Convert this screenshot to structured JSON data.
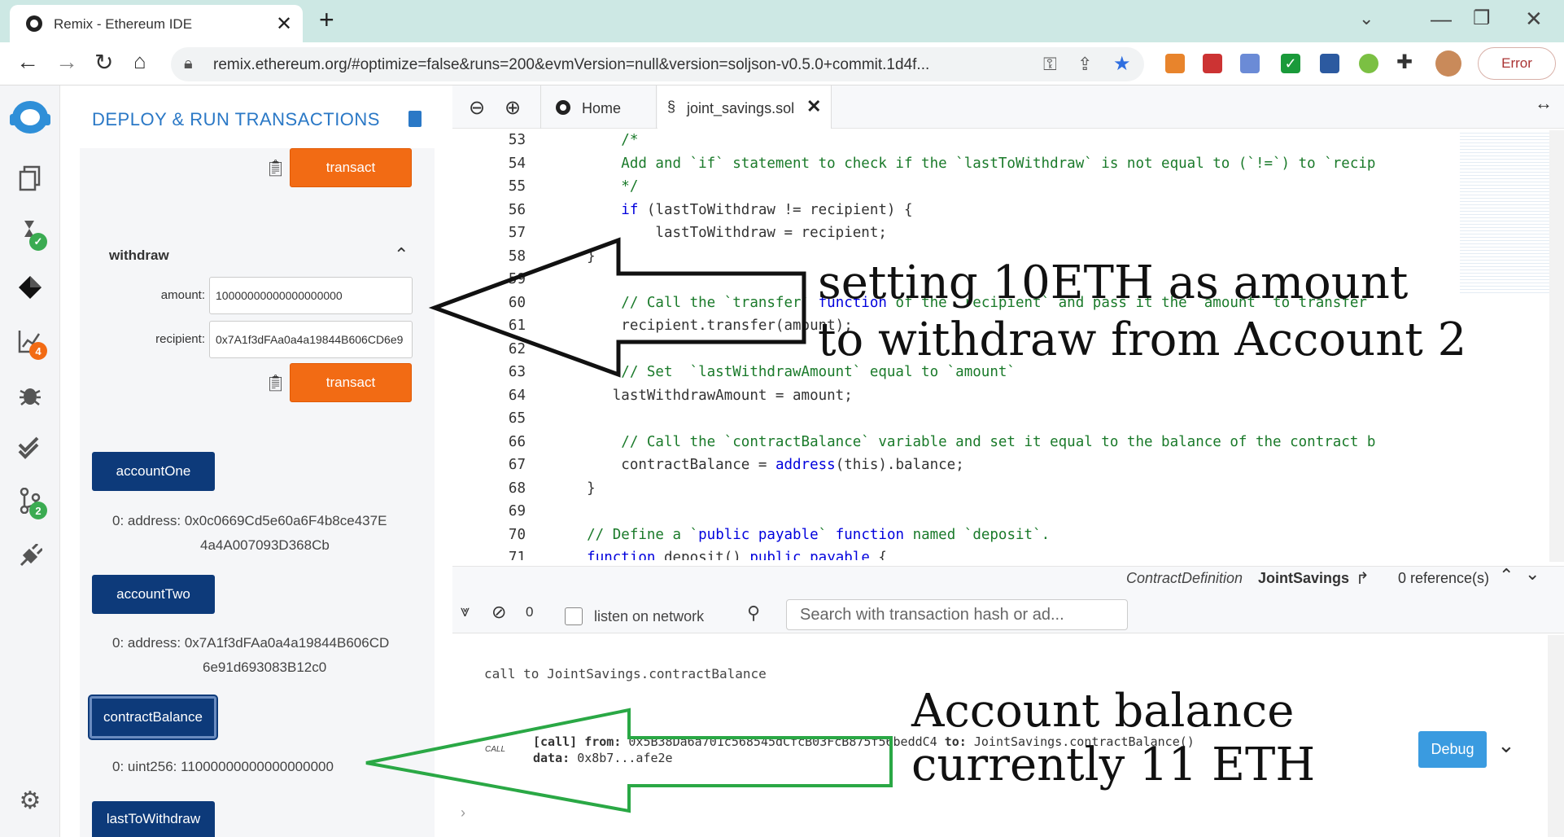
{
  "browser": {
    "tab_title": "Remix - Ethereum IDE",
    "url": "remix.ethereum.org/#optimize=false&runs=200&evmVersion=null&version=soljson-v0.5.0+commit.1d4f...",
    "error_label": "Error"
  },
  "sidebar": {
    "badge_analysis": "4",
    "badge_git": "2"
  },
  "panel": {
    "title": "DEPLOY & RUN TRANSACTIONS",
    "transact_label": "transact",
    "withdraw": {
      "title": "withdraw",
      "amount_label": "amount:",
      "amount_value": "10000000000000000000",
      "recipient_label": "recipient:",
      "recipient_value": "0x7A1f3dFAa0a4a19844B606CD6e9"
    },
    "accountOne": {
      "label": "accountOne",
      "out_line1": "0: address: 0x0c0669Cd5e60a6F4b8ce437E",
      "out_line2": "4a4A007093D368Cb"
    },
    "accountTwo": {
      "label": "accountTwo",
      "out_line1": "0: address: 0x7A1f3dFAa0a4a19844B606CD",
      "out_line2": "6e91d693083B12c0"
    },
    "contractBalance": {
      "label": "contractBalance",
      "out": "0: uint256: 11000000000000000000"
    },
    "lastToWithdraw": {
      "label": "lastToWithdraw"
    }
  },
  "editor": {
    "tabs": [
      {
        "label": "Home"
      },
      {
        "label": "joint_savings.sol"
      }
    ],
    "lines": [
      {
        "n": "53",
        "t": "        /*",
        "c": "cm"
      },
      {
        "n": "54",
        "t": "        Add and `if` statement to check if the `lastToWithdraw` is not equal to (`!=`) to `recip",
        "c": "cm"
      },
      {
        "n": "55",
        "t": "        */",
        "c": "cm"
      },
      {
        "n": "56",
        "t": "        if (lastToWithdraw != recipient) {",
        "c": "kw1"
      },
      {
        "n": "57",
        "t": "            lastToWithdraw = recipient;",
        "c": ""
      },
      {
        "n": "58",
        "t": "    }",
        "c": ""
      },
      {
        "n": "59",
        "t": "",
        "c": ""
      },
      {
        "n": "60",
        "t": "        // Call the `transfer` function of the `recipient` and pass it the `amount` to transfer",
        "c": "cm"
      },
      {
        "n": "61",
        "t": "        recipient.transfer(amount);",
        "c": ""
      },
      {
        "n": "62",
        "t": "",
        "c": ""
      },
      {
        "n": "63",
        "t": "        // Set  `lastWithdrawAmount` equal to `amount`",
        "c": "cm"
      },
      {
        "n": "64",
        "t": "       lastWithdrawAmount = amount;",
        "c": ""
      },
      {
        "n": "65",
        "t": "",
        "c": ""
      },
      {
        "n": "66",
        "t": "        // Call the `contractBalance` variable and set it equal to the balance of the contract b",
        "c": "cm"
      },
      {
        "n": "67",
        "t": "        contractBalance = address(this).balance;",
        "c": "kw2"
      },
      {
        "n": "68",
        "t": "    }",
        "c": ""
      },
      {
        "n": "69",
        "t": "",
        "c": ""
      },
      {
        "n": "70",
        "t": "    // Define a `public payable` function named `deposit`.",
        "c": "cm"
      },
      {
        "n": "71",
        "t": "    function deposit() public payable {",
        "c": "kw3"
      }
    ],
    "status": {
      "def": "ContractDefinition",
      "name": "JointSavings",
      "refs": "0 reference(s)"
    }
  },
  "terminal": {
    "count": "0",
    "listen_label": "listen on network",
    "search_placeholder": "Search with transaction hash or ad...",
    "call_line": "call to JointSavings.contractBalance",
    "call_tag": "CALL",
    "tx_line1_a": "[call]",
    "tx_line1_b": "from:",
    "tx_line1_c": "0x5B38Da6a701c568545dCfcB03FcB875f56beddC4",
    "tx_line1_d": "to:",
    "tx_line1_e": "JointSavings.contractBalance()",
    "tx_line2_a": "data:",
    "tx_line2_b": "0x8b7...afe2e",
    "debug_label": "Debug"
  },
  "annotations": {
    "top_line1": "setting 10ETH as amount",
    "top_line2": "to withdraw from Account 2",
    "bottom_line1": "Account balance",
    "bottom_line2": "currently 11 ETH"
  },
  "colors": {
    "accent_blue": "#0d3a7a",
    "transact_orange": "#f26b14",
    "arrow_green": "#2aa845",
    "debug_blue": "#3a9be0"
  }
}
